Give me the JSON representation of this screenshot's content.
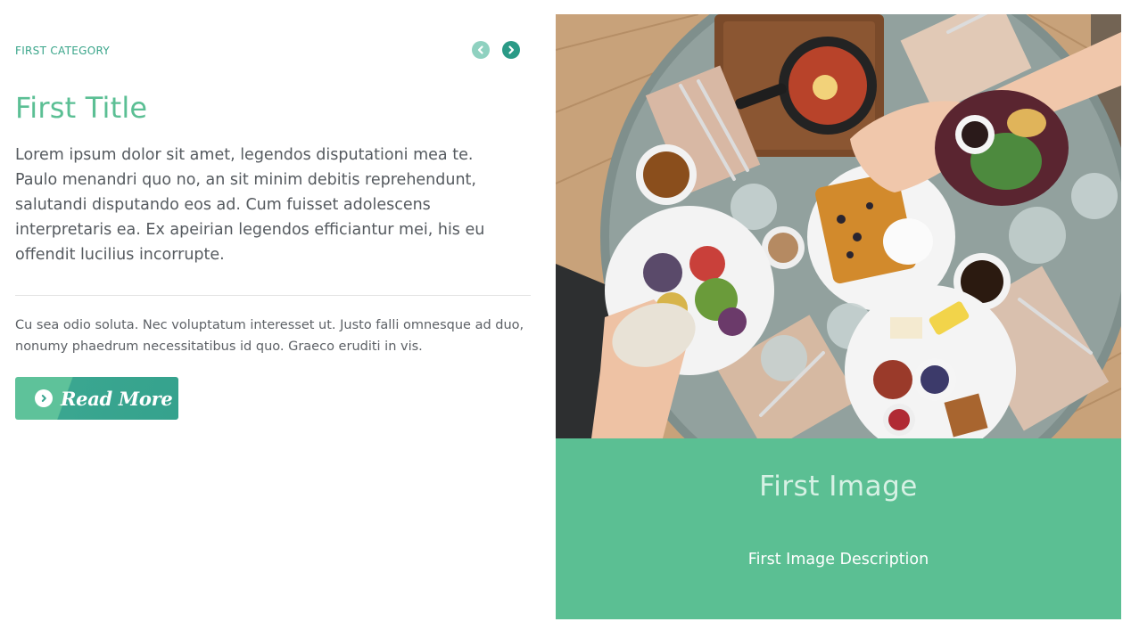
{
  "slide": {
    "category": "FIRST CATEGORY",
    "title": "First Title",
    "lead": "Lorem ipsum dolor sit amet, legendos disputationi mea te. Paulo menandri quo no, an sit minim debitis reprehendunt, salutandi disputando eos ad. Cum fuisset adolescens interpretaris ea. Ex apeirian legendos efficiantur mei, his eu offendit lucilius incorrupte.",
    "body": "Cu sea odio soluta. Nec voluptatum interesset ut. Justo falli omnesque ad duo, nonumy phaedrum necessitatibus id quo. Graeco eruditi in vis.",
    "read_more_label": "Read More"
  },
  "navigation": {
    "prev_icon": "chevron-left-circle-icon",
    "next_icon": "chevron-right-circle-icon"
  },
  "image": {
    "title": "First Image",
    "description": "First Image Description",
    "subject": "overhead photo of breakfast table with plates, waffles, coffee cups and hands"
  },
  "colors": {
    "accent": "#5bbf93",
    "accent_dark": "#35a28d",
    "category_text": "#3aa58a",
    "body_text": "#555a5f"
  }
}
